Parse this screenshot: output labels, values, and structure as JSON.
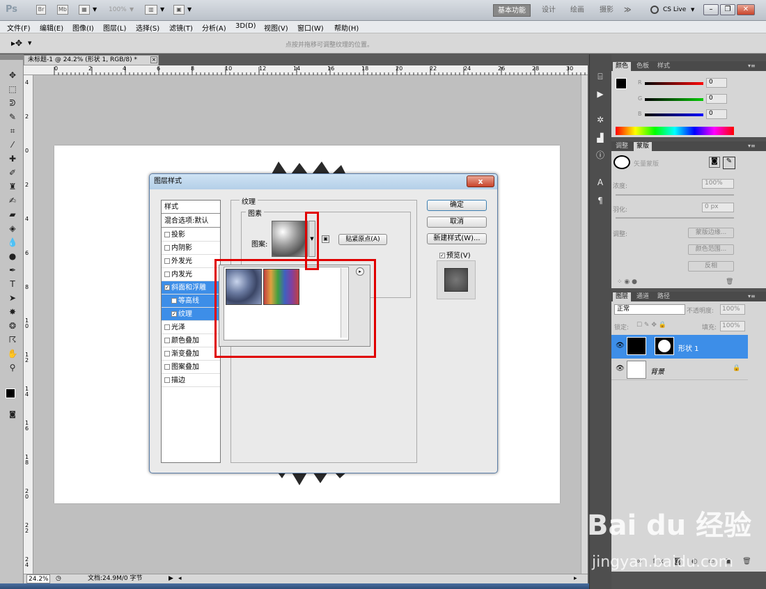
{
  "app": {
    "logo": "Ps",
    "zoom_display": "100%",
    "workspaces": [
      "基本功能",
      "设计",
      "绘画",
      "摄影"
    ],
    "more": "≫",
    "cslive": "CS Live"
  },
  "menu": [
    "文件(F)",
    "编辑(E)",
    "图像(I)",
    "图层(L)",
    "选择(S)",
    "滤镜(T)",
    "分析(A)",
    "3D(D)",
    "视图(V)",
    "窗口(W)",
    "帮助(H)"
  ],
  "options": {
    "hint": "点按并拖移可调整纹理的位置。"
  },
  "document": {
    "tab_title": "未标题-1 @ 24.2% (形状 1, RGB/8) *",
    "ruler_h": [
      "0",
      "2",
      "4",
      "6",
      "8",
      "10",
      "12",
      "14",
      "16",
      "18",
      "20",
      "22",
      "24",
      "26",
      "28",
      "30"
    ],
    "ruler_v": [
      "4",
      "2",
      "0",
      "2",
      "4",
      "6",
      "8",
      "1 0",
      "1 2",
      "1 4",
      "1 6",
      "1 8",
      "2 0",
      "2 2",
      "2 4"
    ]
  },
  "status": {
    "zoom": "24.2%",
    "doc": "文档:24.9M/0 字节"
  },
  "color_panel": {
    "tabs": [
      "颜色",
      "色板",
      "样式"
    ],
    "channels": [
      {
        "label": "R",
        "value": "0",
        "color": "#e00000"
      },
      {
        "label": "G",
        "value": "0",
        "color": "#00b000"
      },
      {
        "label": "B",
        "value": "0",
        "color": "#0000e0"
      }
    ]
  },
  "masks_panel": {
    "tabs": [
      "调整",
      "蒙版"
    ],
    "title": "矢量蒙版",
    "density_label": "浓度:",
    "density_value": "100%",
    "feather_label": "羽化:",
    "feather_value": "0 px",
    "refine_label": "调整:",
    "buttons": [
      "蒙版边缘...",
      "颜色范围...",
      "反相"
    ]
  },
  "layers_panel": {
    "tabs": [
      "图层",
      "通道",
      "路径"
    ],
    "blend_mode": "正常",
    "opacity_label": "不透明度:",
    "opacity": "100%",
    "lock_label": "锁定:",
    "fill_label": "填充:",
    "fill": "100%",
    "layers": [
      {
        "name": "形状 1",
        "selected": true
      },
      {
        "name": "背景",
        "selected": false
      }
    ]
  },
  "dialog": {
    "title": "图层样式",
    "close": "x",
    "styles_header": "样式",
    "blend_default": "混合选项:默认",
    "items": [
      {
        "label": "投影",
        "checked": false,
        "indent": false,
        "selected": false
      },
      {
        "label": "内阴影",
        "checked": false,
        "indent": false,
        "selected": false
      },
      {
        "label": "外发光",
        "checked": false,
        "indent": false,
        "selected": false
      },
      {
        "label": "内发光",
        "checked": false,
        "indent": false,
        "selected": false
      },
      {
        "label": "斜面和浮雕",
        "checked": true,
        "indent": false,
        "selected": true
      },
      {
        "label": "等高线",
        "checked": false,
        "indent": true,
        "selected": true
      },
      {
        "label": "纹理",
        "checked": true,
        "indent": true,
        "selected": true
      },
      {
        "label": "光泽",
        "checked": false,
        "indent": false,
        "selected": false
      },
      {
        "label": "颜色叠加",
        "checked": false,
        "indent": false,
        "selected": false
      },
      {
        "label": "渐变叠加",
        "checked": false,
        "indent": false,
        "selected": false
      },
      {
        "label": "图案叠加",
        "checked": false,
        "indent": false,
        "selected": false
      },
      {
        "label": "描边",
        "checked": false,
        "indent": false,
        "selected": false
      }
    ],
    "texture_group": "纹理",
    "pattern_group": "图素",
    "pattern_label": "图案:",
    "snap_button": "贴紧原点(A)",
    "ok": "确定",
    "cancel": "取消",
    "new_style": "新建样式(W)...",
    "preview": "预览(V)"
  },
  "watermark": {
    "line1": "Bai du 经验",
    "line2": "jingyan.baidu.com"
  }
}
